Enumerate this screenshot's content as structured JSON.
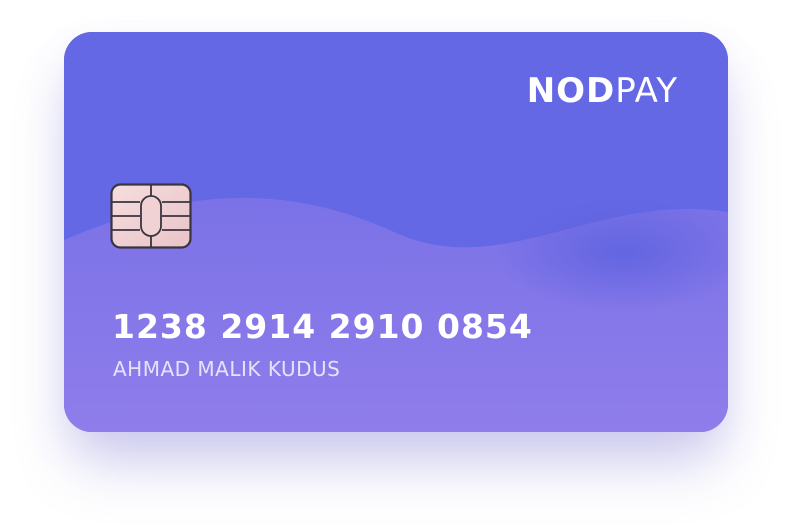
{
  "card": {
    "brand_bold": "NOD",
    "brand_light": "PAY",
    "number": "1238 2914 2910 0854",
    "holder": "AHMAD MALIK KUDUS"
  },
  "colors": {
    "card_top": "#6468e4",
    "card_bottom": "#8e7ae9",
    "wave": "#7a72e8",
    "text": "#ffffff",
    "chip": "#f3d6d6"
  },
  "icons": {
    "chip": "emv-chip-icon"
  }
}
